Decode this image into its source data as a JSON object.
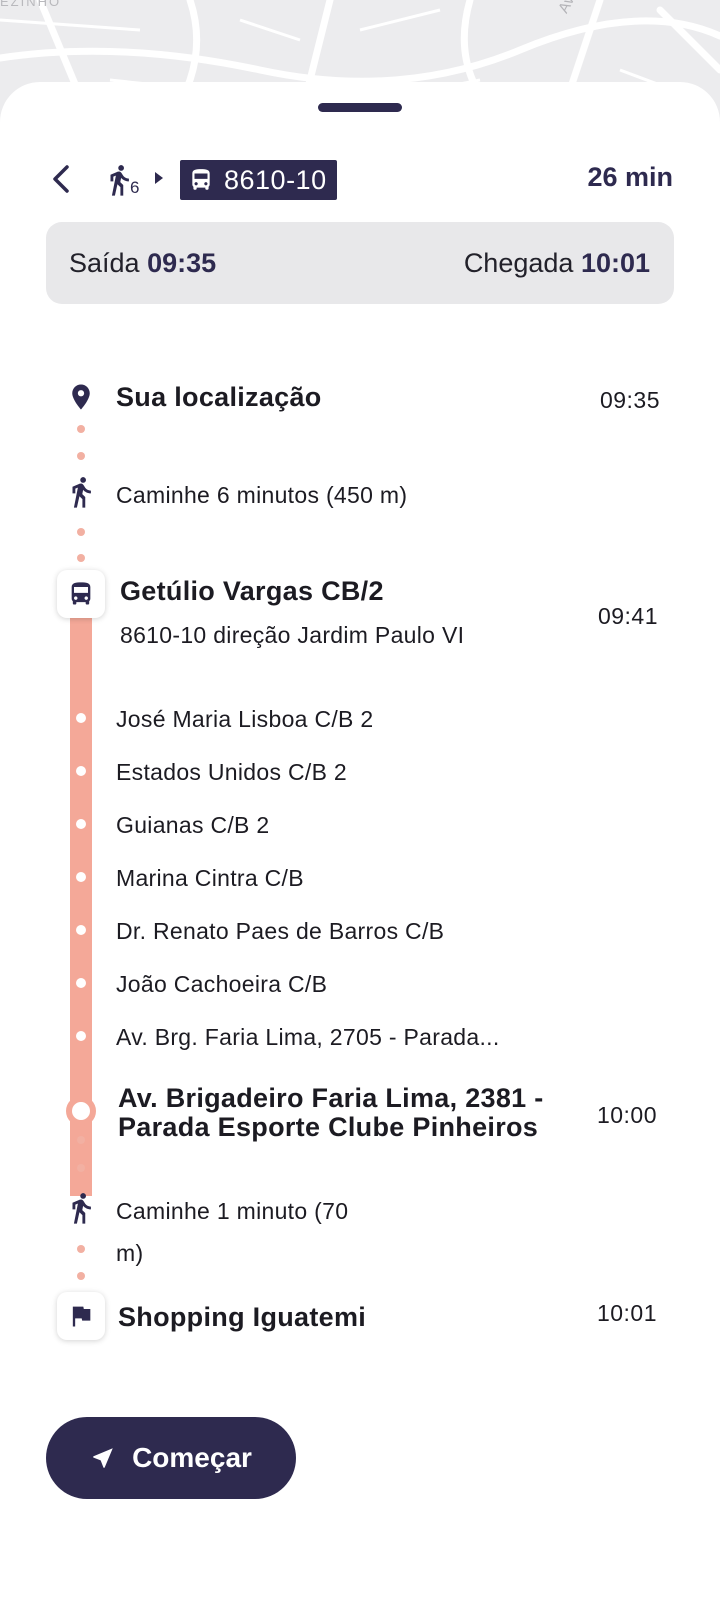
{
  "map": {
    "corner_label": "EZINHO",
    "street_label": "Aven"
  },
  "header": {
    "walk_minutes": "6",
    "route_code": "8610-10",
    "duration": "26 min"
  },
  "times": {
    "departure_label": "Saída",
    "departure_time": "09:35",
    "arrival_label": "Chegada",
    "arrival_time": "10:01"
  },
  "timeline": {
    "origin": {
      "name": "Sua localização",
      "time": "09:35"
    },
    "walk1": {
      "text": "Caminhe 6 minutos (450 m)"
    },
    "board": {
      "name": "Getúlio Vargas CB/2",
      "direction": "8610-10 direção Jardim Paulo VI",
      "time": "09:41"
    },
    "stops": [
      "José Maria Lisboa C/B 2",
      "Estados Unidos C/B 2",
      "Guianas C/B 2",
      "Marina Cintra C/B",
      "Dr. Renato Paes de Barros C/B",
      "João Cachoeira C/B",
      "Av. Brg. Faria Lima, 2705 - Parada..."
    ],
    "alight": {
      "line1": "Av. Brigadeiro Faria Lima, 2381 -",
      "line2": "Parada Esporte Clube Pinheiros",
      "time": "10:00"
    },
    "walk2": {
      "line1": "Caminhe 1 minuto (70",
      "line2": "m)"
    },
    "destination": {
      "name": "Shopping Iguatemi",
      "time": "10:01"
    }
  },
  "actions": {
    "start_label": "Começar"
  },
  "colors": {
    "primary": "#2e2a4f",
    "route_line": "#f4a898",
    "dots": "#f2b0a2",
    "times_bg": "#e8e8ea"
  }
}
